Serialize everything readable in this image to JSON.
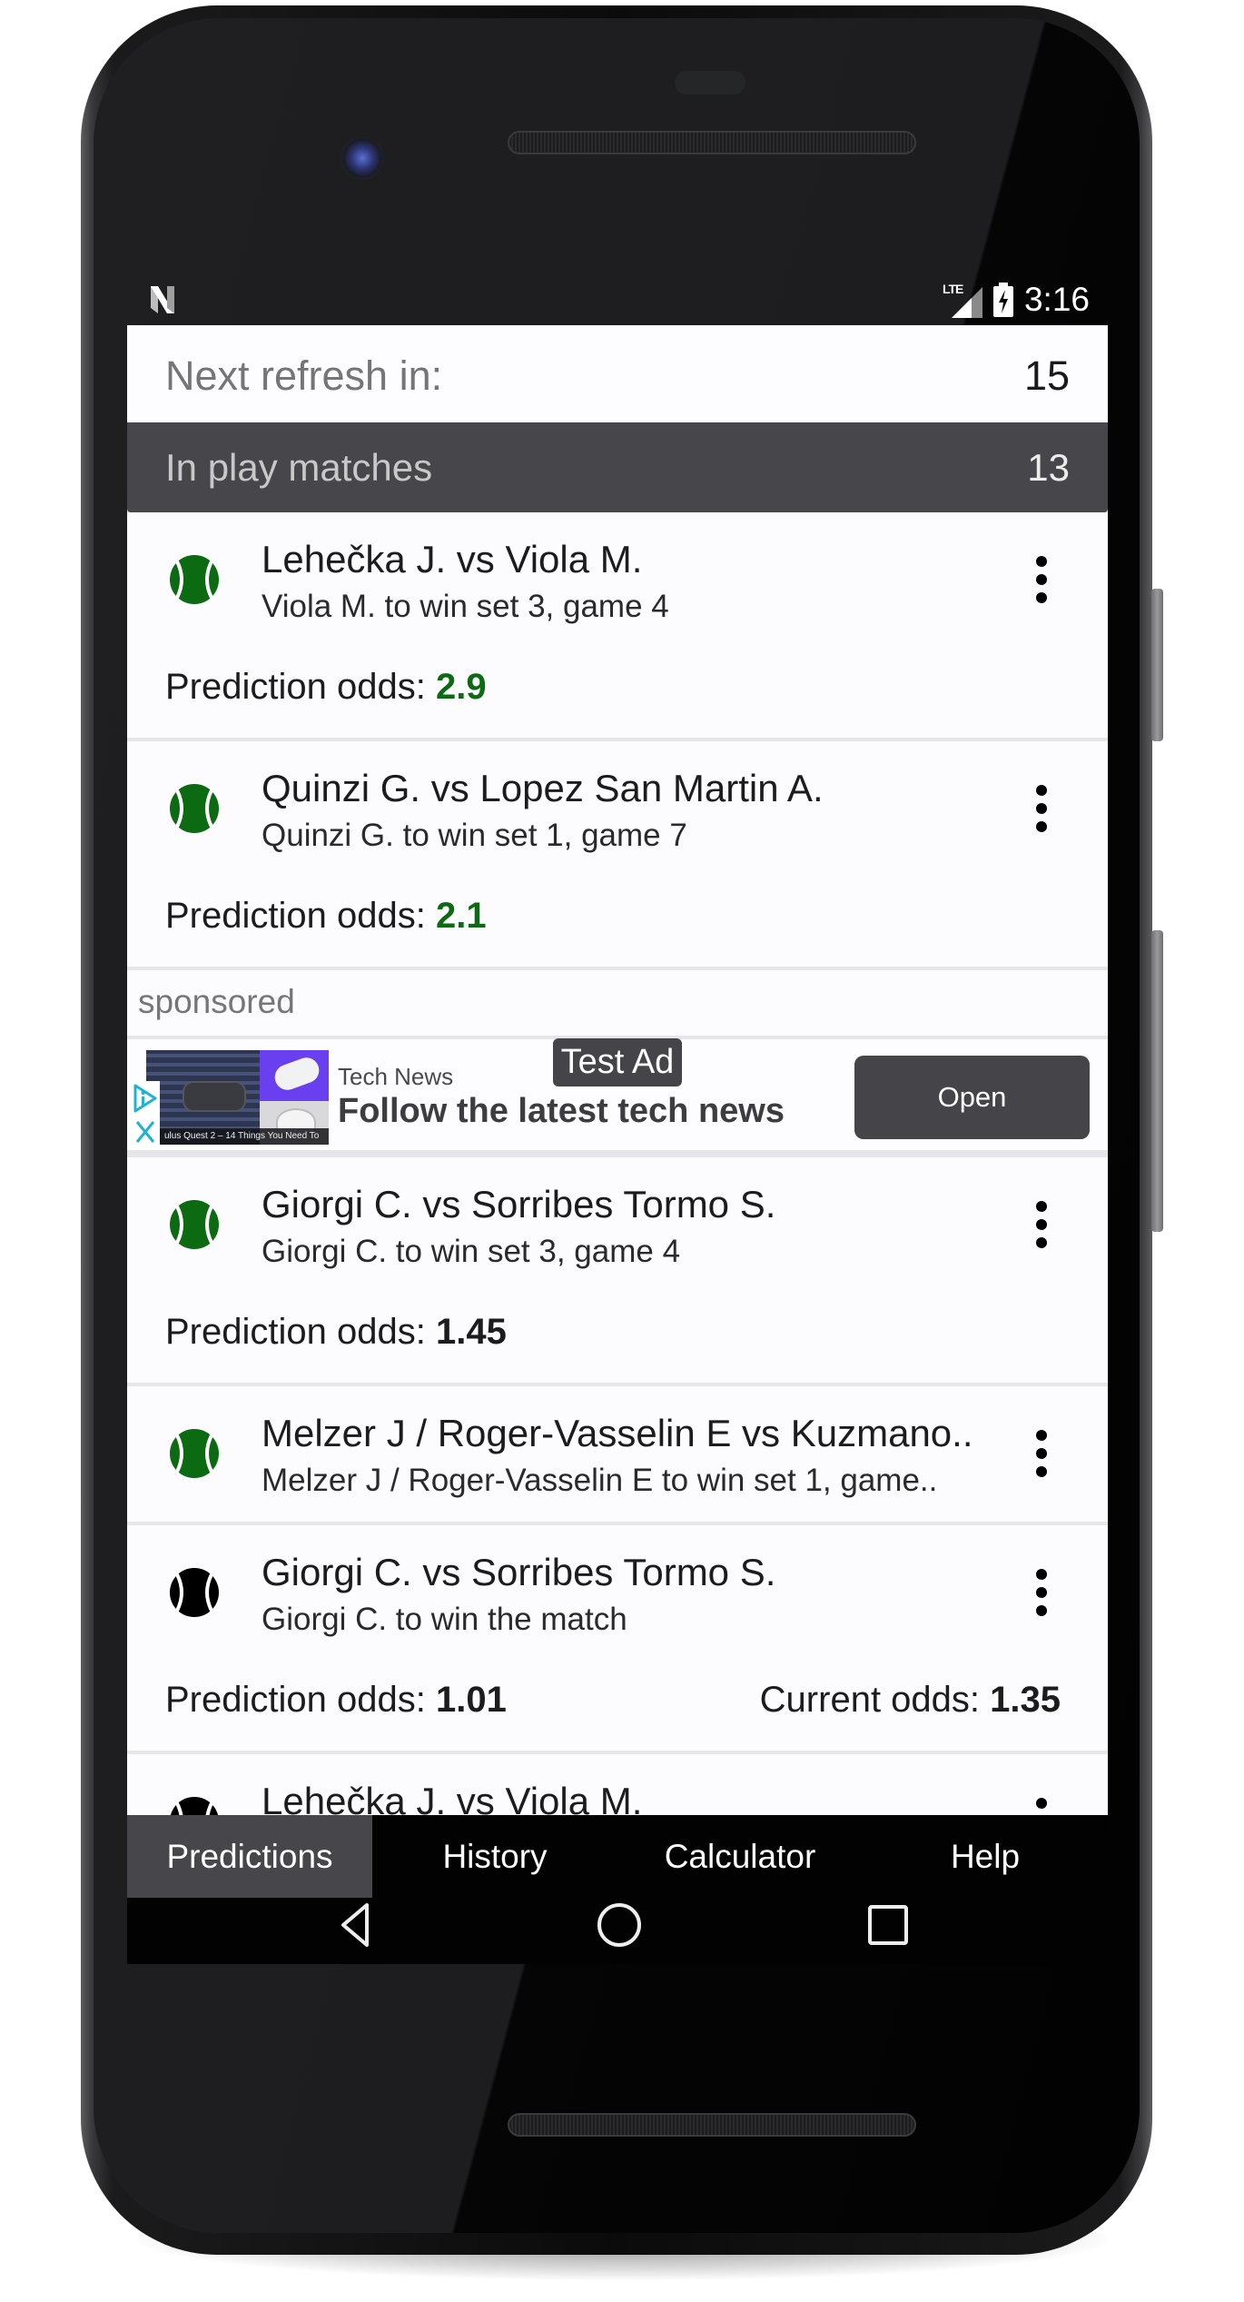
{
  "statusbar": {
    "network": "LTE",
    "time": "3:16"
  },
  "refresh": {
    "label": "Next refresh in:",
    "value": "15"
  },
  "in_play": {
    "label": "In play matches",
    "count": "13"
  },
  "matches": [
    {
      "title": "Lehečka J. vs Viola M.",
      "subtitle": "Viola M. to win set 3, game 4",
      "icon_color": "#0c6a12",
      "prediction_label": "Prediction odds:",
      "prediction_odds": "2.9",
      "odds_color": "green"
    },
    {
      "title": "Quinzi G. vs Lopez San Martin A.",
      "subtitle": "Quinzi G. to win set 1, game 7",
      "icon_color": "#0c6a12",
      "prediction_label": "Prediction odds:",
      "prediction_odds": "2.1",
      "odds_color": "green"
    },
    {
      "title": "Giorgi C. vs Sorribes Tormo S.",
      "subtitle": "Giorgi C. to win set 3, game 4",
      "icon_color": "#0c6a12",
      "prediction_label": "Prediction odds:",
      "prediction_odds": "1.45",
      "odds_color": "black"
    },
    {
      "title": "Melzer J / Roger-Vasselin E vs Kuzmano..",
      "subtitle": "Melzer J / Roger-Vasselin E to win set 1, game..",
      "icon_color": "#0c6a12"
    },
    {
      "title": "Giorgi C. vs Sorribes Tormo S.",
      "subtitle": "Giorgi C. to win the match",
      "icon_color": "#000000",
      "prediction_label": "Prediction odds:",
      "prediction_odds": "1.01",
      "current_label": "Current odds:",
      "current_odds": "1.35",
      "odds_color": "black"
    },
    {
      "title": "Lehečka J. vs Viola M.",
      "icon_color": "#000000"
    }
  ],
  "ad": {
    "sponsored_label": "sponsored",
    "source": "Tech News",
    "headline": "Follow the latest tech news",
    "badge": "Test Ad",
    "button_label": "Open",
    "image_caption": "ulus Quest 2 – 14 Things You Need To"
  },
  "tabs": [
    {
      "label": "Predictions",
      "active": true
    },
    {
      "label": "History",
      "active": false
    },
    {
      "label": "Calculator",
      "active": false
    },
    {
      "label": "Help",
      "active": false
    }
  ],
  "colors": {
    "accent_green": "#0c6a12",
    "header_bg": "#47464a",
    "tabbar_bg": "#020202",
    "adchoices": "#1fb3d1"
  }
}
